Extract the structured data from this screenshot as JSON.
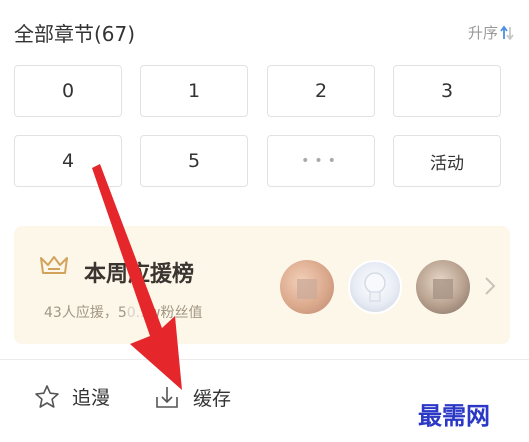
{
  "header": {
    "title": "全部章节(67)",
    "sort_label": "升序"
  },
  "chapters": [
    {
      "label": "0"
    },
    {
      "label": "1"
    },
    {
      "label": "2"
    },
    {
      "label": "3"
    },
    {
      "label": "4"
    },
    {
      "label": "5"
    },
    {
      "label": "•••"
    },
    {
      "label": "活动"
    }
  ],
  "support": {
    "title": "本周应援榜",
    "subtitle": "43人应援，5",
    "subtitle_rest": "w粉丝值",
    "subtitle_obscured": "0.9"
  },
  "bottom_bar": {
    "follow_label": "追漫",
    "cache_label": "缓存"
  },
  "watermark": "最需网",
  "colors": {
    "accent": "#4a90e2",
    "arrow": "#e5262a",
    "support_bg": "#fdf7ea",
    "watermark": "#2b38c6"
  }
}
